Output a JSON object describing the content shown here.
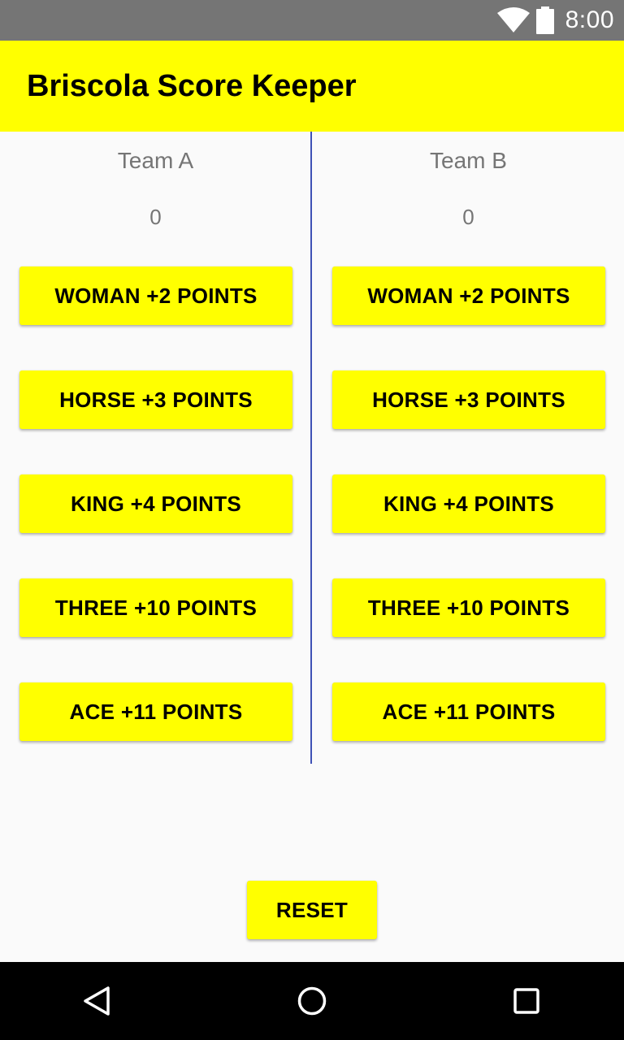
{
  "status_bar": {
    "time": "8:00",
    "icons": [
      "wifi-icon",
      "battery-icon"
    ]
  },
  "app_bar": {
    "title": "Briscola Score Keeper",
    "color": "#ffff00"
  },
  "teams": [
    {
      "name": "Team A",
      "score": "0",
      "buttons": [
        "WOMAN +2 POINTS",
        "HORSE +3 POINTS",
        "KING +4 POINTS",
        "THREE +10 POINTS",
        "ACE +11 POINTS"
      ]
    },
    {
      "name": "Team B",
      "score": "0",
      "buttons": [
        "WOMAN +2 POINTS",
        "HORSE +3 POINTS",
        "KING +4 POINTS",
        "THREE +10 POINTS",
        "ACE +11 POINTS"
      ]
    }
  ],
  "reset_label": "RESET",
  "nav_bar": {
    "icons": [
      "back-icon",
      "home-icon",
      "recents-icon"
    ]
  },
  "colors": {
    "accent": "#ffff00",
    "divider": "#3f51b5",
    "status_bar": "#757575",
    "label_text": "#757575"
  }
}
